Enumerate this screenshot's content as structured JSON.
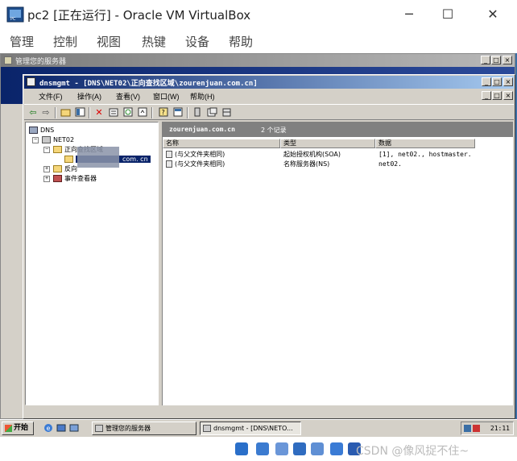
{
  "host": {
    "title": "pc2 [正在运行] - Oracle VM VirtualBox",
    "minimize_glyph": "─",
    "maximize_glyph": "☐",
    "close_glyph": "✕",
    "menus": [
      "管理",
      "控制",
      "视图",
      "热键",
      "设备",
      "帮助"
    ]
  },
  "back_window": {
    "title": "管理您的服务器"
  },
  "dns_window": {
    "title": "dnsmgmt - [DNS\\NET02\\正向查找区域\\zourenjuan.com.cn]",
    "menus": [
      "文件(F)",
      "操作(A)",
      "查看(V)",
      "窗口(W)",
      "帮助(H)"
    ],
    "toolbar_icons": [
      "back-arrow-icon",
      "forward-arrow-icon",
      "up-folder-icon",
      "show-tree-icon",
      "delete-icon",
      "properties-icon",
      "refresh-icon",
      "export-icon",
      "help-icon",
      "console-icon",
      "server-icon",
      "new-record-icon",
      "domain-icon"
    ]
  },
  "tree": {
    "root": "DNS",
    "server": "NET02",
    "forward_zones": "正向查找区域",
    "zone_suffix": "com. cn",
    "reverse_zones": "反向",
    "event_viewer": "事件查看器"
  },
  "result": {
    "zone": "zourenjuan.com.cn",
    "count": "2 个记录",
    "columns": [
      "名称",
      "类型",
      "数据"
    ],
    "records": [
      {
        "name": "(与父文件夹相同)",
        "type": "起始授权机构(SOA)",
        "data": "[1], net02., hostmaster."
      },
      {
        "name": "(与父文件夹相同)",
        "type": "名称服务器(NS)",
        "data": "net02."
      }
    ]
  },
  "taskbar": {
    "start": "开始",
    "tasks": [
      "管理您的服务器",
      "dnsmgmt - [DNS\\NETO..."
    ],
    "clock": "21:11"
  },
  "watermark": "CSDN @像风捉不住~"
}
